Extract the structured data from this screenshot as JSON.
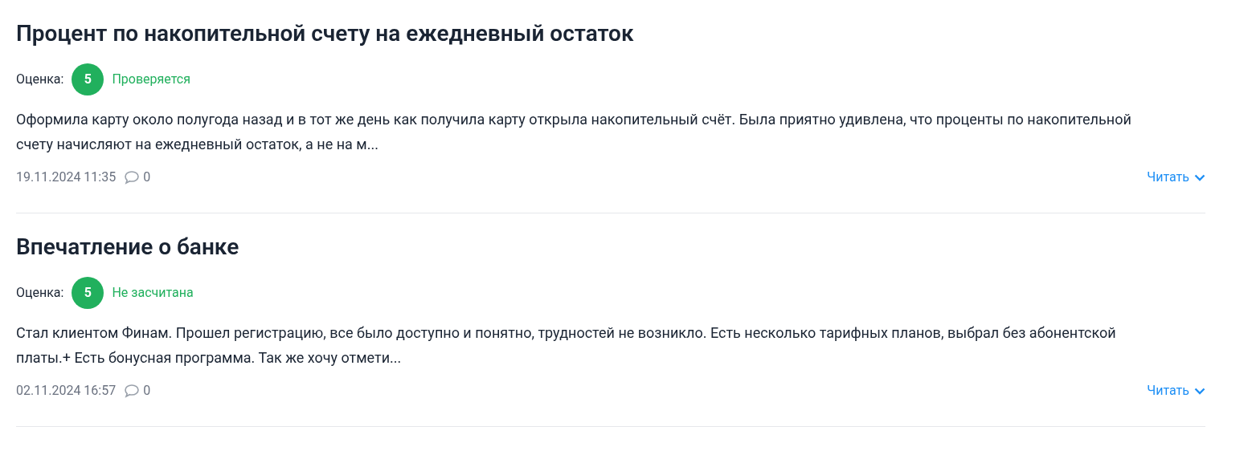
{
  "reviews": [
    {
      "title": "Процент по накопительной счету на ежедневный остаток",
      "rating_label": "Оценка:",
      "score": "5",
      "status": "Проверяется",
      "text": "Оформила карту около полугода назад и в тот же день как получила карту открыла накопительный счёт. Была приятно удивлена, что проценты по накопительной счету начисляют на ежедневный остаток, а не на м...",
      "date": "19.11.2024 11:35",
      "comments": "0",
      "read_label": "Читать"
    },
    {
      "title": "Впечатление о банке",
      "rating_label": "Оценка:",
      "score": "5",
      "status": "Не засчитана",
      "text": "Стал клиентом Финам. Прошел регистрацию, все было доступно и понятно, трудностей не возникло. Есть несколько тарифных планов, выбрал без абонентской платы.+ Есть бонусная программа. Так же хочу отмети...",
      "date": "02.11.2024 16:57",
      "comments": "0",
      "read_label": "Читать"
    }
  ]
}
